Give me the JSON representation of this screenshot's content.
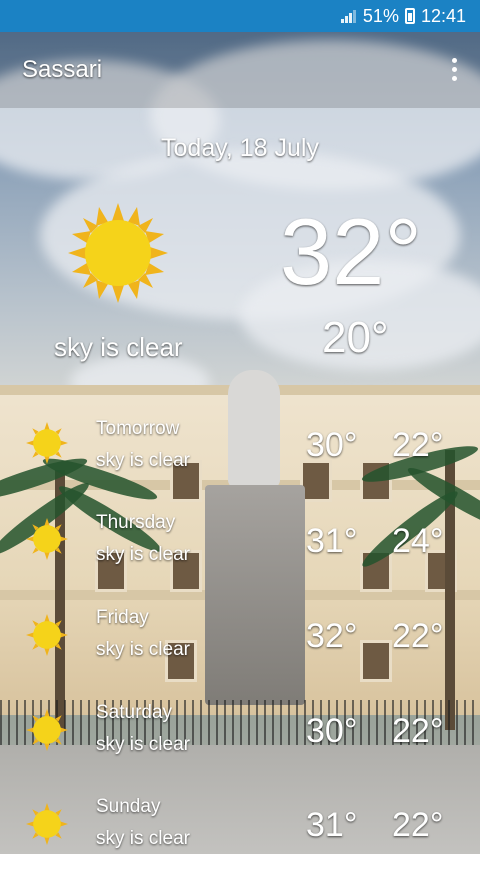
{
  "status_bar": {
    "battery": "51%",
    "time": "12:41"
  },
  "app_bar": {
    "title": "Sassari"
  },
  "today": {
    "date": "Today, 18 July",
    "condition": "sky is clear",
    "max": "32°",
    "min": "20°",
    "icon": "sun-icon"
  },
  "forecast": [
    {
      "day": "Tomorrow",
      "condition": "sky is clear",
      "max": "30°",
      "min": "22°",
      "icon": "sun-icon"
    },
    {
      "day": "Thursday",
      "condition": "sky is clear",
      "max": "31°",
      "min": "24°",
      "icon": "sun-icon"
    },
    {
      "day": "Friday",
      "condition": "sky is clear",
      "max": "32°",
      "min": "22°",
      "icon": "sun-icon"
    },
    {
      "day": "Saturday",
      "condition": "sky is clear",
      "max": "30°",
      "min": "22°",
      "icon": "sun-icon"
    },
    {
      "day": "Sunday",
      "condition": "sky is clear",
      "max": "31°",
      "min": "22°",
      "icon": "sun-icon"
    }
  ],
  "colors": {
    "status_bar": "#1b82c4",
    "sun_fill": "#f5d31a",
    "sun_rays": "#f0b41c"
  }
}
